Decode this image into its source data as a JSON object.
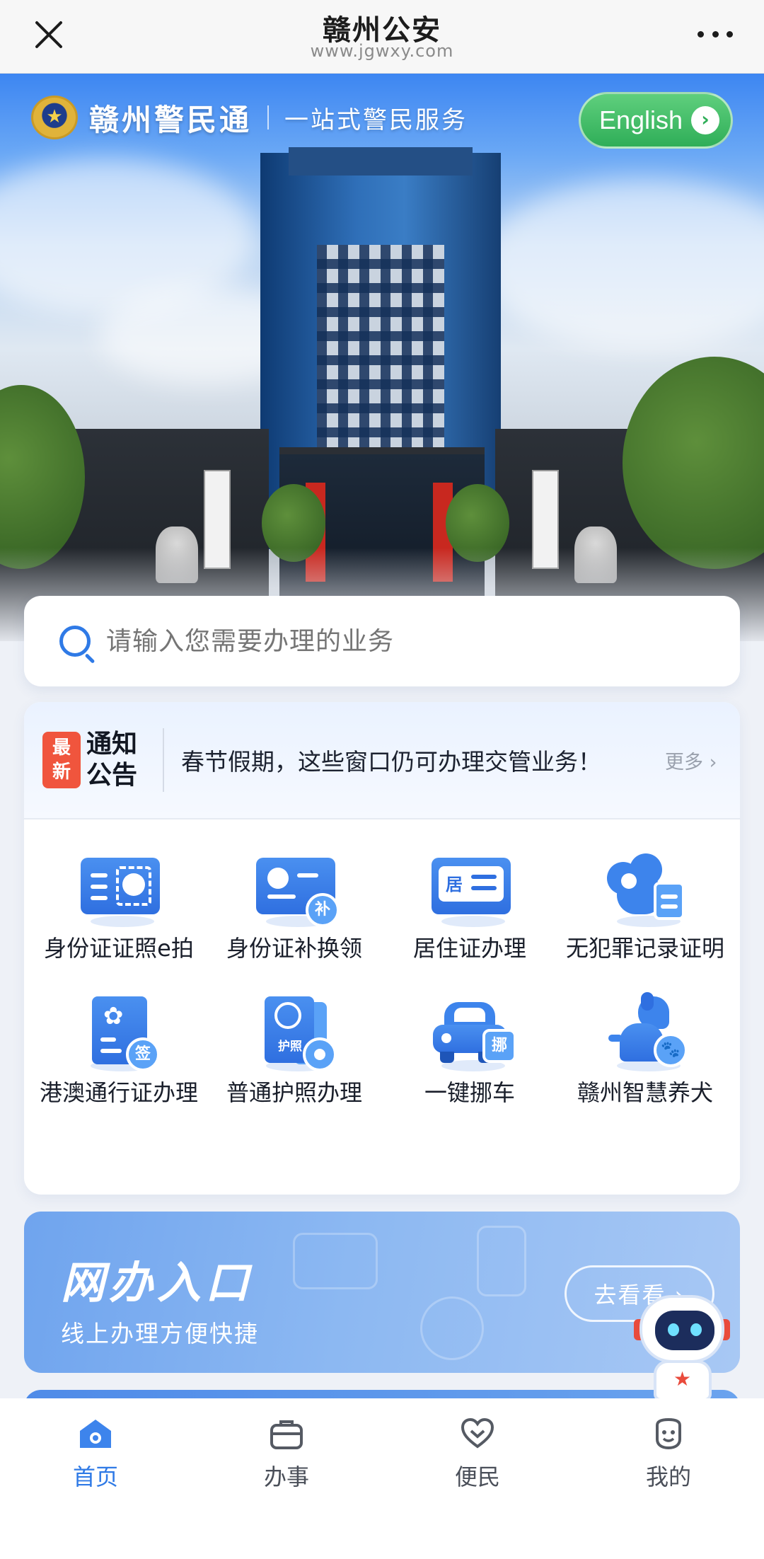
{
  "browser": {
    "title": "赣州公安",
    "url": "www.jgwxy.com"
  },
  "header": {
    "brand_name": "赣州警民通",
    "slogan": "一站式警民服务",
    "english_label": "English"
  },
  "search": {
    "placeholder": "请输入您需要办理的业务"
  },
  "notice": {
    "badge_line1": "最",
    "badge_line2": "新",
    "label_line1": "通知",
    "label_line2": "公告",
    "text": "春节假期，这些窗口仍可办理交管业务！",
    "more_label": "更多 ›"
  },
  "services": [
    {
      "label": "身份证证照e拍",
      "icon": "id-photo-icon"
    },
    {
      "label": "身份证补换领",
      "icon": "id-reissue-icon"
    },
    {
      "label": "居住证办理",
      "icon": "residence-permit-icon"
    },
    {
      "label": "无犯罪记录证明",
      "icon": "no-crime-record-icon"
    },
    {
      "label": "港澳通行证办理",
      "icon": "hk-macau-permit-icon"
    },
    {
      "label": "普通护照办理",
      "icon": "passport-icon"
    },
    {
      "label": "一键挪车",
      "icon": "move-car-icon"
    },
    {
      "label": "赣州智慧养犬",
      "icon": "smart-dog-icon"
    }
  ],
  "service_badges": {
    "reissue": "补",
    "residence": "居",
    "visa": "签",
    "passport": "护照",
    "move": "挪"
  },
  "promo": {
    "title": "网办入口",
    "subtitle": "线上办理方便快捷",
    "button_label": "去看看 ›"
  },
  "tabs": [
    {
      "label": "首页",
      "icon": "home-icon",
      "active": true
    },
    {
      "label": "办事",
      "icon": "briefcase-icon",
      "active": false
    },
    {
      "label": "便民",
      "icon": "heart-icon",
      "active": false
    },
    {
      "label": "我的",
      "icon": "profile-icon",
      "active": false
    }
  ],
  "colors": {
    "primary": "#2f7ae6",
    "english_button": "#2fae58",
    "notice_badge": "#f0553d",
    "tab_inactive": "#4a4f59"
  }
}
